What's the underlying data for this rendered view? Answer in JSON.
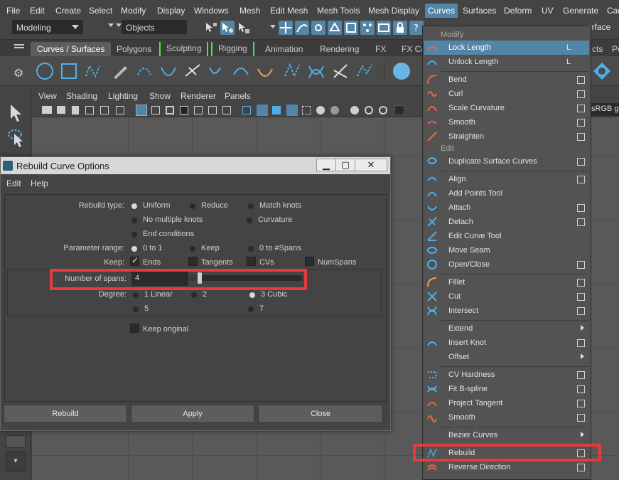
{
  "menubar": {
    "items": [
      "File",
      "Edit",
      "Create",
      "Select",
      "Modify",
      "Display",
      "Windows",
      "Mesh",
      "Edit Mesh",
      "Mesh Tools",
      "Mesh Display",
      "Curves",
      "Surfaces",
      "Deform",
      "UV",
      "Generate",
      "Cac"
    ],
    "active": "Curves"
  },
  "statusline": {
    "menuset": "Modeling",
    "selection_mode": "Objects",
    "right_text": "urface"
  },
  "shelf_tabs": [
    "Curves / Surfaces",
    "Polygons",
    "Sculpting",
    "Rigging",
    "Animation",
    "Rendering",
    "FX",
    "FX Ca"
  ],
  "shelf_tabs_right": [
    "cts",
    "Pe"
  ],
  "viewport": {
    "menu": [
      "View",
      "Shading",
      "Lighting",
      "Show",
      "Renderer",
      "Panels"
    ],
    "colorspace": "sRGB ga"
  },
  "dialog": {
    "title": "Rebuild Curve Options",
    "menu": [
      "Edit",
      "Help"
    ],
    "rebuild_type_label": "Rebuild type:",
    "rebuild_types": [
      "Uniform",
      "Reduce",
      "Match knots",
      "No multiple knots",
      "Curvature",
      "End conditions"
    ],
    "rebuild_type_selected": "Uniform",
    "parameter_range_label": "Parameter range:",
    "parameter_ranges": [
      "0 to 1",
      "Keep",
      "0 to #Spans"
    ],
    "parameter_range_selected": "0 to 1",
    "keep_label": "Keep:",
    "keep_options": [
      "Ends",
      "Tangents",
      "CVs",
      "NumSpans"
    ],
    "keep_checked": [
      "Ends"
    ],
    "spans_label": "Number of spans:",
    "spans_value": "4",
    "spans_slider_fraction": 0.07,
    "degree_label": "Degree:",
    "degrees": [
      "1 Linear",
      "2",
      "3 Cubic",
      "5",
      "7"
    ],
    "degree_selected": "3 Cubic",
    "keep_original": "Keep original",
    "buttons": [
      "Rebuild",
      "Apply",
      "Close"
    ]
  },
  "curves_menu": {
    "section_modify": "Modify",
    "section_edit": "Edit",
    "items": [
      {
        "label": "Lock Length",
        "key": "L"
      },
      {
        "label": "Unlock Length",
        "key": "L"
      },
      {
        "label": "Bend"
      },
      {
        "label": "Curl"
      },
      {
        "label": "Scale Curvature"
      },
      {
        "label": "Smooth"
      },
      {
        "label": "Straighten"
      },
      {
        "label": "Duplicate Surface Curves"
      },
      {
        "label": "Align"
      },
      {
        "label": "Add Points Tool"
      },
      {
        "label": "Attach"
      },
      {
        "label": "Detach"
      },
      {
        "label": "Edit Curve Tool"
      },
      {
        "label": "Move Seam"
      },
      {
        "label": "Open/Close"
      },
      {
        "label": "Fillet"
      },
      {
        "label": "Cut"
      },
      {
        "label": "Intersect"
      },
      {
        "label": "Extend"
      },
      {
        "label": "Insert Knot"
      },
      {
        "label": "Offset"
      },
      {
        "label": "CV Hardness"
      },
      {
        "label": "Fit B-spline"
      },
      {
        "label": "Project Tangent"
      },
      {
        "label": "Smooth"
      },
      {
        "label": "Bezier Curves"
      },
      {
        "label": "Rebuild"
      },
      {
        "label": "Reverse Direction"
      }
    ]
  },
  "colors": {
    "highlight": "#5285a6",
    "annotation": "#e83a3a"
  }
}
